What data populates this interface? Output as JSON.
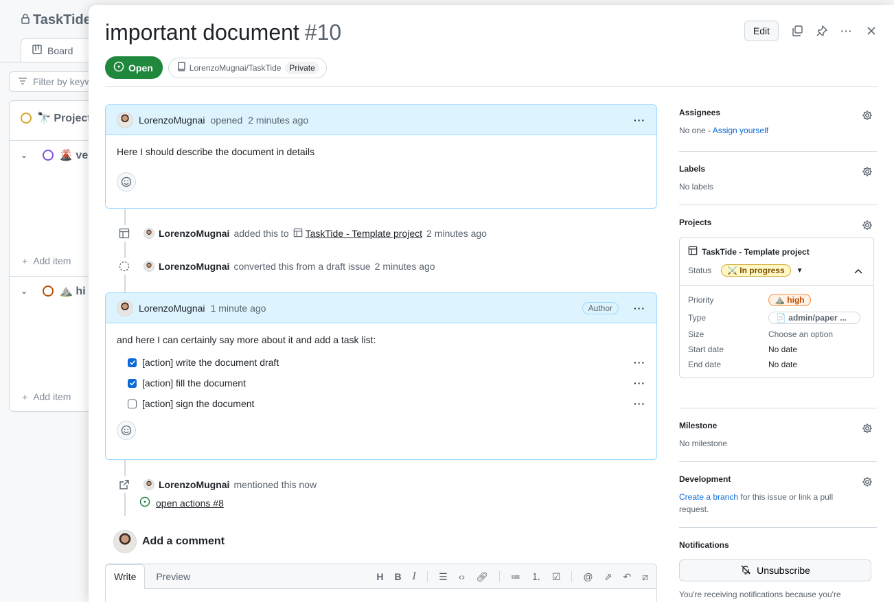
{
  "background": {
    "app_title": "TaskTide",
    "tab_board": "Board",
    "filter_placeholder": "Filter by keyword",
    "group_project": "🔭 Project",
    "row_ve": "🌋 ve",
    "row_hi": "⛰️ hi",
    "add_item": "Add item"
  },
  "issue": {
    "title": "important document",
    "number": "#10",
    "edit_label": "Edit",
    "state": "Open",
    "repo": "LorenzoMugnai/TaskTide",
    "visibility": "Private"
  },
  "comment1": {
    "author": "LorenzoMugnai",
    "action": "opened",
    "time": "2 minutes ago",
    "body": "Here I should describe the document in details"
  },
  "events": {
    "added": {
      "user": "LorenzoMugnai",
      "text": "added this to",
      "project": "TaskTide - Template project",
      "time": "2 minutes ago"
    },
    "converted": {
      "user": "LorenzoMugnai",
      "text": "converted this from a draft issue",
      "time": "2 minutes ago"
    }
  },
  "comment2": {
    "author": "LorenzoMugnai",
    "time": "1 minute ago",
    "badge": "Author",
    "body": "and here I can certainly say more about it and add a task list:",
    "tasks": [
      {
        "label": "[action] write the document draft",
        "checked": true
      },
      {
        "label": "[action] fill the document",
        "checked": true
      },
      {
        "label": "[action] sign the document",
        "checked": false
      }
    ]
  },
  "mention": {
    "user": "LorenzoMugnai",
    "text": "mentioned this now",
    "link": "open actions #8"
  },
  "add_comment": {
    "title": "Add a comment",
    "tab_write": "Write",
    "tab_preview": "Preview"
  },
  "sidebar": {
    "assignees": {
      "title": "Assignees",
      "none": "No one -",
      "assign": "Assign yourself"
    },
    "labels": {
      "title": "Labels",
      "value": "No labels"
    },
    "projects": {
      "title": "Projects",
      "name": "TaskTide - Template project",
      "status_label": "Status",
      "status": "⚔️ In progress",
      "fields": [
        {
          "label": "Priority",
          "value": "⛰️ high"
        },
        {
          "label": "Type",
          "value": "📄 admin/paper ..."
        },
        {
          "label": "Size",
          "value": "Choose an option"
        },
        {
          "label": "Start date",
          "value": "No date"
        },
        {
          "label": "End date",
          "value": "No date"
        }
      ]
    },
    "milestone": {
      "title": "Milestone",
      "value": "No milestone"
    },
    "development": {
      "title": "Development",
      "link": "Create a branch",
      "text": "for this issue or link a pull request."
    },
    "notifications": {
      "title": "Notifications",
      "button": "Unsubscribe",
      "note": "You're receiving notifications because you're"
    }
  },
  "colors": {
    "open": "#1f883d",
    "accent": "#0969da",
    "comment_header": "#ddf4ff"
  }
}
